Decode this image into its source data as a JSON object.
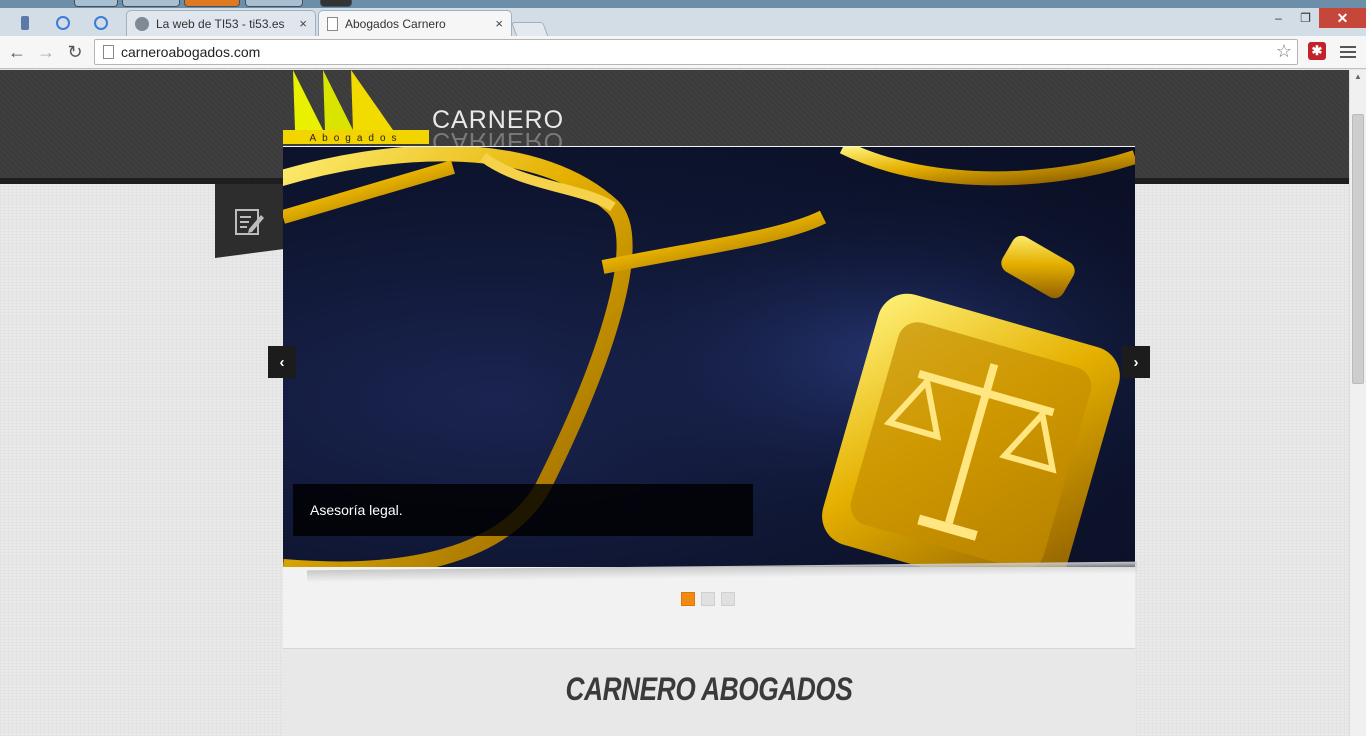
{
  "browser": {
    "pinned_tabs": [
      "lock-tab-icon",
      "refresh-tab-icon",
      "refresh-tab-icon"
    ],
    "tabs": [
      {
        "title": "La web de TI53 - ti53.es",
        "close": "×"
      },
      {
        "title": "Abogados Carnero",
        "close": "×"
      }
    ],
    "window_controls": {
      "minimize": "‒",
      "restore": "❐",
      "close": "✕"
    },
    "nav": {
      "back": "←",
      "forward": "→",
      "reload": "↻"
    },
    "url": "carneroabogados.com",
    "star": "☆",
    "extension_label": "✱"
  },
  "site": {
    "logo_text": "CARNERO",
    "logo_sub": "Abogados",
    "colors": {
      "accent_orange": "#f18a12",
      "logo_yellow": "#e9f000"
    },
    "slider": {
      "caption": "Asesoría legal.",
      "prev": "‹",
      "next": "›",
      "dot_count": 3,
      "active_dot": 0
    },
    "section_title": "CARNERO ABOGADOS"
  }
}
